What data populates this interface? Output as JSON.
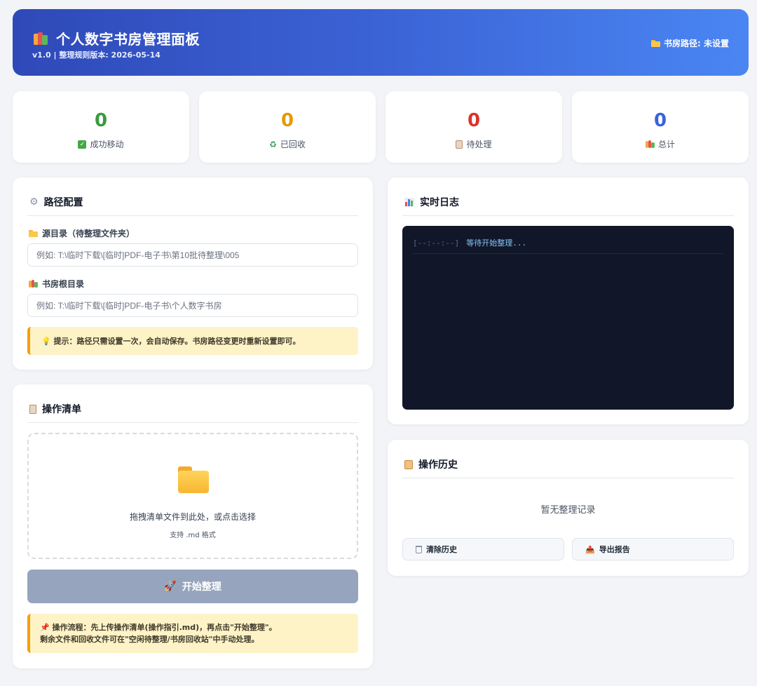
{
  "header": {
    "title": "个人数字书房管理面板",
    "subtitle": "v1.0 | 整理规则版本: 2026-05-14",
    "path_label": "书房路径: 未设置"
  },
  "stats": [
    {
      "value": "0",
      "label": "成功移动",
      "color": "#3a9a3e",
      "icon": "check-box-icon"
    },
    {
      "value": "0",
      "label": "已回收",
      "color": "#e39a0c",
      "icon": "recycle-icon"
    },
    {
      "value": "0",
      "label": "待处理",
      "color": "#d9342b",
      "icon": "clipboard-icon"
    },
    {
      "value": "0",
      "label": "总计",
      "color": "#3b63d6",
      "icon": "books-icon"
    }
  ],
  "path_config": {
    "title": "路径配置",
    "source_label": "源目录（待整理文件夹）",
    "source_placeholder": "例如: T:\\临时下载\\[临时]PDF-电子书\\第10批待整理\\005",
    "library_label": "书房根目录",
    "library_placeholder": "例如: T:\\临时下载\\[临时]PDF-电子书\\个人数字书房",
    "tip": "提示：路径只需设置一次，会自动保存。书房路径变更时重新设置即可。"
  },
  "operation_list": {
    "title": "操作清单",
    "dropzone_text": "拖拽清单文件到此处，或点击选择",
    "dropzone_sub": "支持 .md 格式",
    "start_button": "开始整理",
    "flow_tip_line1": "操作流程：先上传操作清单(操作指引.md)，再点击\"开始整理\"。",
    "flow_tip_line2": "剩余文件和回收文件可在\"空闲待整理/书房回收站\"中手动处理。"
  },
  "realtime_log": {
    "title": "实时日志",
    "lines": [
      {
        "time": "[--:--:--]",
        "message": "等待开始整理..."
      }
    ]
  },
  "history": {
    "title": "操作历史",
    "empty_text": "暂无整理记录",
    "clear_button": "清除历史",
    "export_button": "导出报告"
  }
}
